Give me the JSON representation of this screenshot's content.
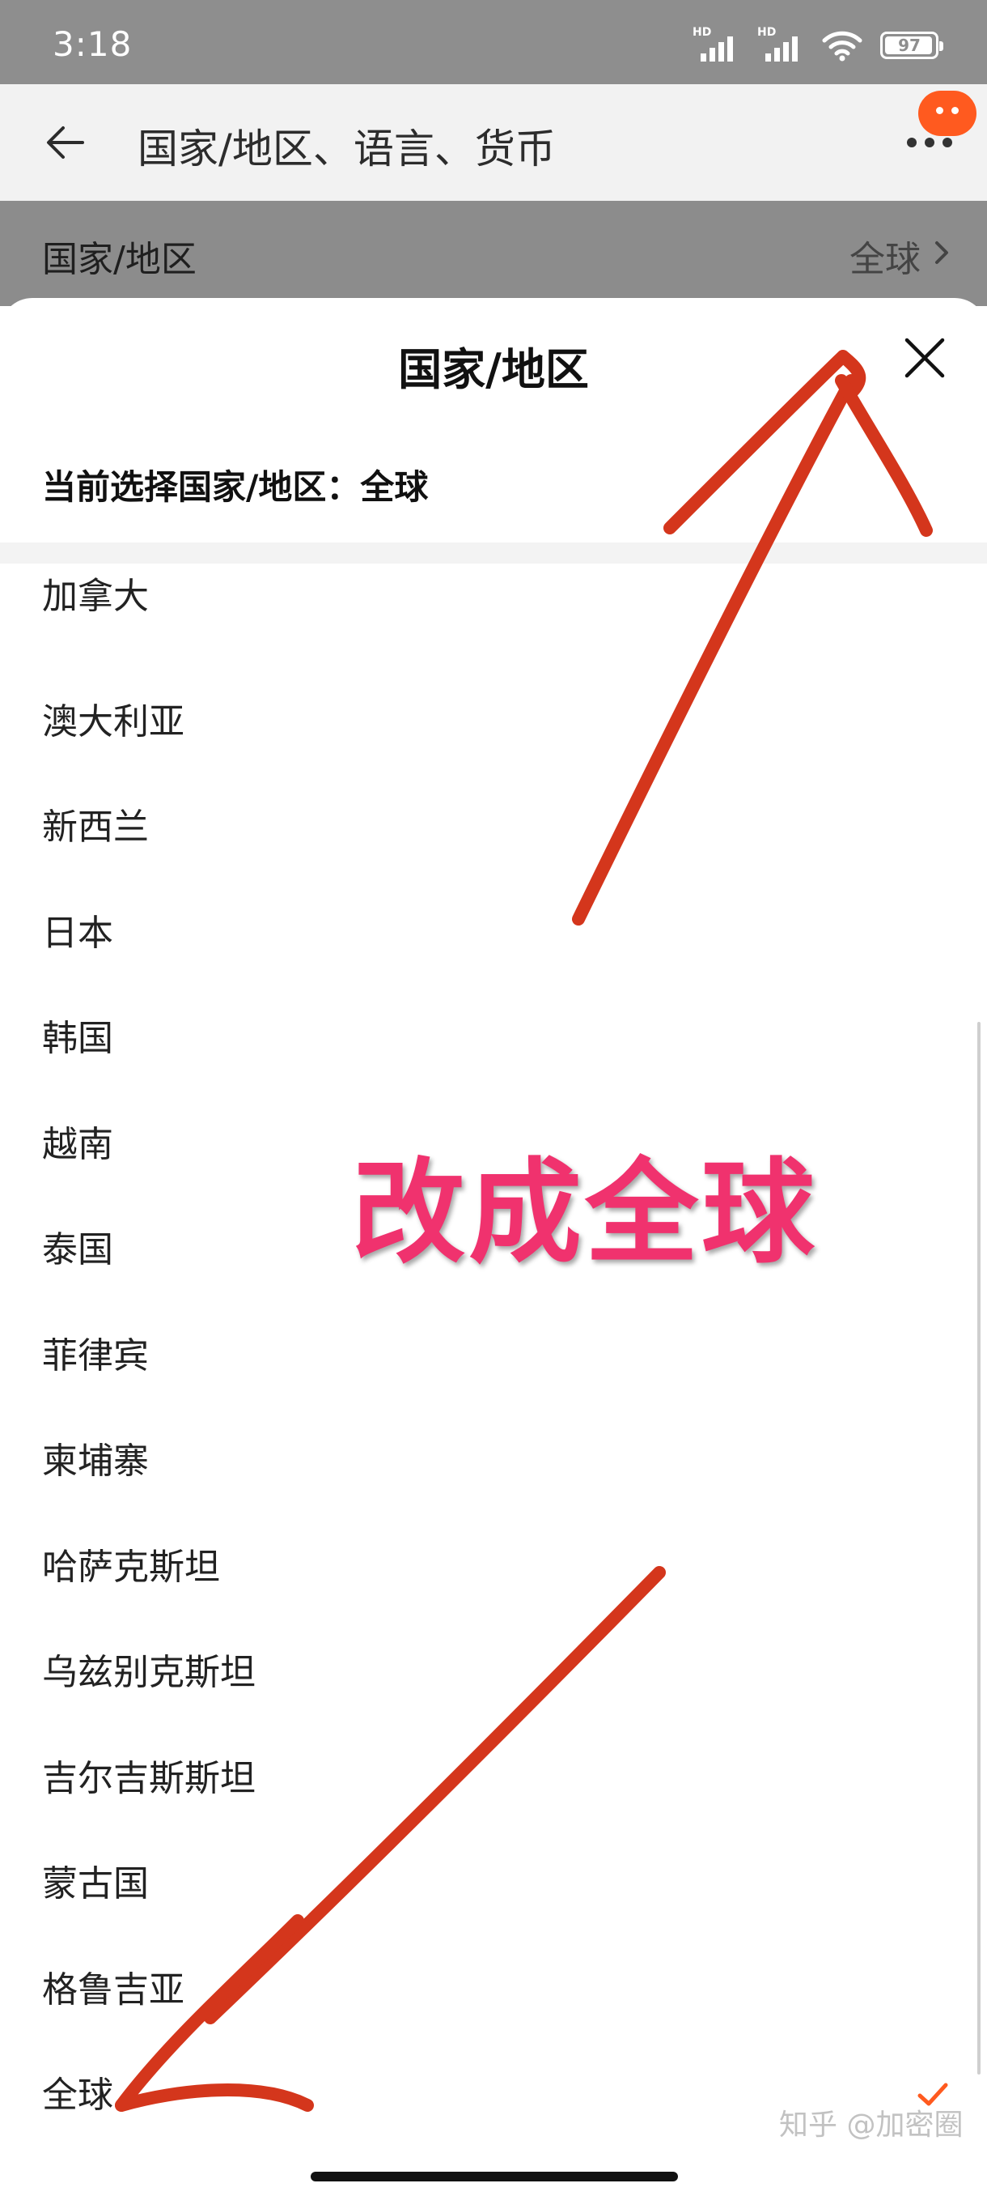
{
  "status_bar": {
    "time": "3:18",
    "signal_label": "HD",
    "battery_level": "97",
    "battery_fraction": 0.97
  },
  "header": {
    "title": "国家/地区、语言、货币",
    "back_icon": "arrow-left-icon",
    "more_icon": "more-dots-icon"
  },
  "setting_row": {
    "label": "国家/地区",
    "value": "全球"
  },
  "sheet": {
    "title": "国家/地区",
    "current_selection": "当前选择国家/地区：全球",
    "countries": [
      {
        "name": "加拿大",
        "selected": false
      },
      {
        "name": "澳大利亚",
        "selected": false
      },
      {
        "name": "新西兰",
        "selected": false
      },
      {
        "name": "日本",
        "selected": false
      },
      {
        "name": "韩国",
        "selected": false
      },
      {
        "name": "越南",
        "selected": false
      },
      {
        "name": "泰国",
        "selected": false
      },
      {
        "name": "菲律宾",
        "selected": false
      },
      {
        "name": "柬埔寨",
        "selected": false
      },
      {
        "name": "哈萨克斯坦",
        "selected": false
      },
      {
        "name": "乌兹别克斯坦",
        "selected": false
      },
      {
        "name": "吉尔吉斯斯坦",
        "selected": false
      },
      {
        "name": "蒙古国",
        "selected": false
      },
      {
        "name": "格鲁吉亚",
        "selected": false
      },
      {
        "name": "全球",
        "selected": true
      }
    ]
  },
  "annotations": {
    "text": "改成全球",
    "text_color": "#f0326e",
    "arrow_color": "#d4361c"
  },
  "watermark": "知乎 @加密圈",
  "colors": {
    "accent": "#ff5a1f",
    "check": "#ff5a1f",
    "overlay_gray": "#8c8c8c"
  }
}
